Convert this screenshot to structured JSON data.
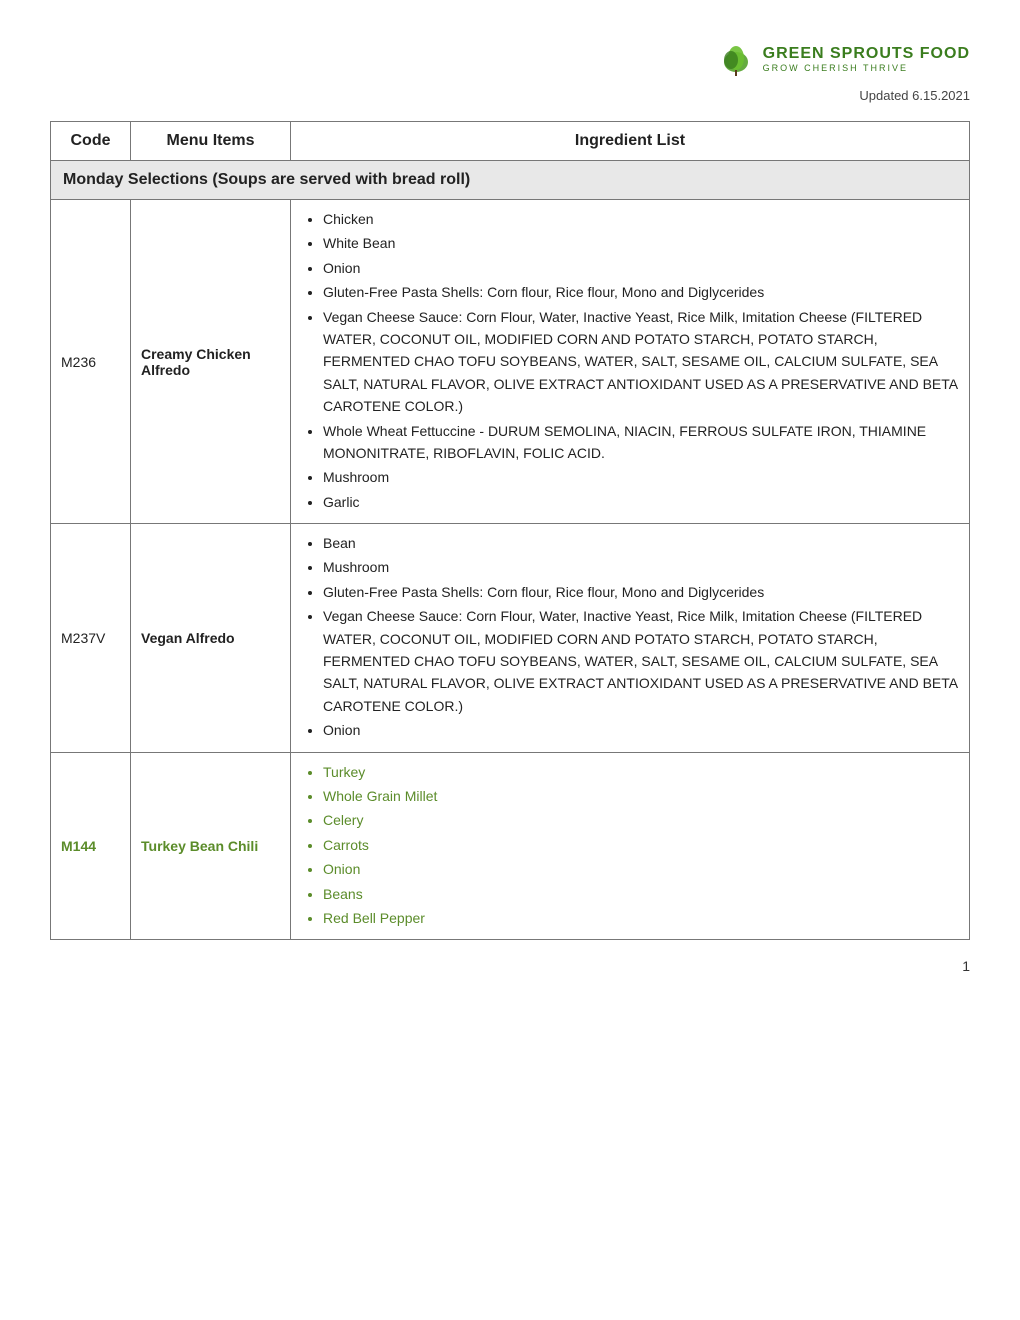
{
  "header": {
    "logo_main": "Green Sprouts Food",
    "logo_sub": "Grow Cherish Thrive",
    "updated": "Updated 6.15.2021"
  },
  "table": {
    "columns": [
      "Code",
      "Menu Items",
      "Ingredient List"
    ],
    "sections": [
      {
        "title": "Monday Selections (Soups are served with bread roll)",
        "rows": [
          {
            "code": "M236",
            "menu": "Creamy Chicken Alfredo",
            "green": false,
            "ingredients": [
              "Chicken",
              "White Bean",
              "Onion",
              "Gluten-Free Pasta Shells: Corn flour, Rice flour, Mono and Diglycerides",
              "Vegan Cheese Sauce: Corn Flour, Water, Inactive Yeast, Rice Milk, Imitation Cheese (FILTERED WATER, COCONUT OIL, MODIFIED CORN AND POTATO STARCH, POTATO STARCH, FERMENTED CHAO TOFU SOYBEANS, WATER, SALT, SESAME OIL, CALCIUM SULFATE, SEA SALT, NATURAL FLAVOR, OLIVE EXTRACT ANTIOXIDANT USED AS A PRESERVATIVE AND BETA CAROTENE COLOR.)",
              "Whole Wheat Fettuccine - DURUM SEMOLINA, NIACIN, FERROUS SULFATE IRON, THIAMINE MONONITRATE, RIBOFLAVIN, FOLIC ACID.",
              "Mushroom",
              "Garlic"
            ]
          },
          {
            "code": "M237V",
            "menu": "Vegan Alfredo",
            "green": false,
            "ingredients": [
              "Bean",
              "Mushroom",
              "Gluten-Free Pasta Shells: Corn flour, Rice flour, Mono and Diglycerides",
              "Vegan Cheese Sauce: Corn Flour, Water, Inactive Yeast, Rice Milk, Imitation Cheese (FILTERED WATER, COCONUT OIL, MODIFIED CORN AND POTATO STARCH, POTATO STARCH, FERMENTED CHAO TOFU SOYBEANS, WATER, SALT, SESAME OIL, CALCIUM SULFATE, SEA SALT, NATURAL FLAVOR, OLIVE EXTRACT ANTIOXIDANT USED AS A PRESERVATIVE AND BETA CAROTENE COLOR.)",
              "Onion"
            ]
          },
          {
            "code": "M144",
            "menu": "Turkey Bean Chili",
            "green": true,
            "ingredients": [
              "Turkey",
              "Whole Grain Millet",
              "Celery",
              "Carrots",
              "Onion",
              "Beans",
              "Red Bell Pepper"
            ]
          }
        ]
      }
    ]
  },
  "page_number": "1"
}
